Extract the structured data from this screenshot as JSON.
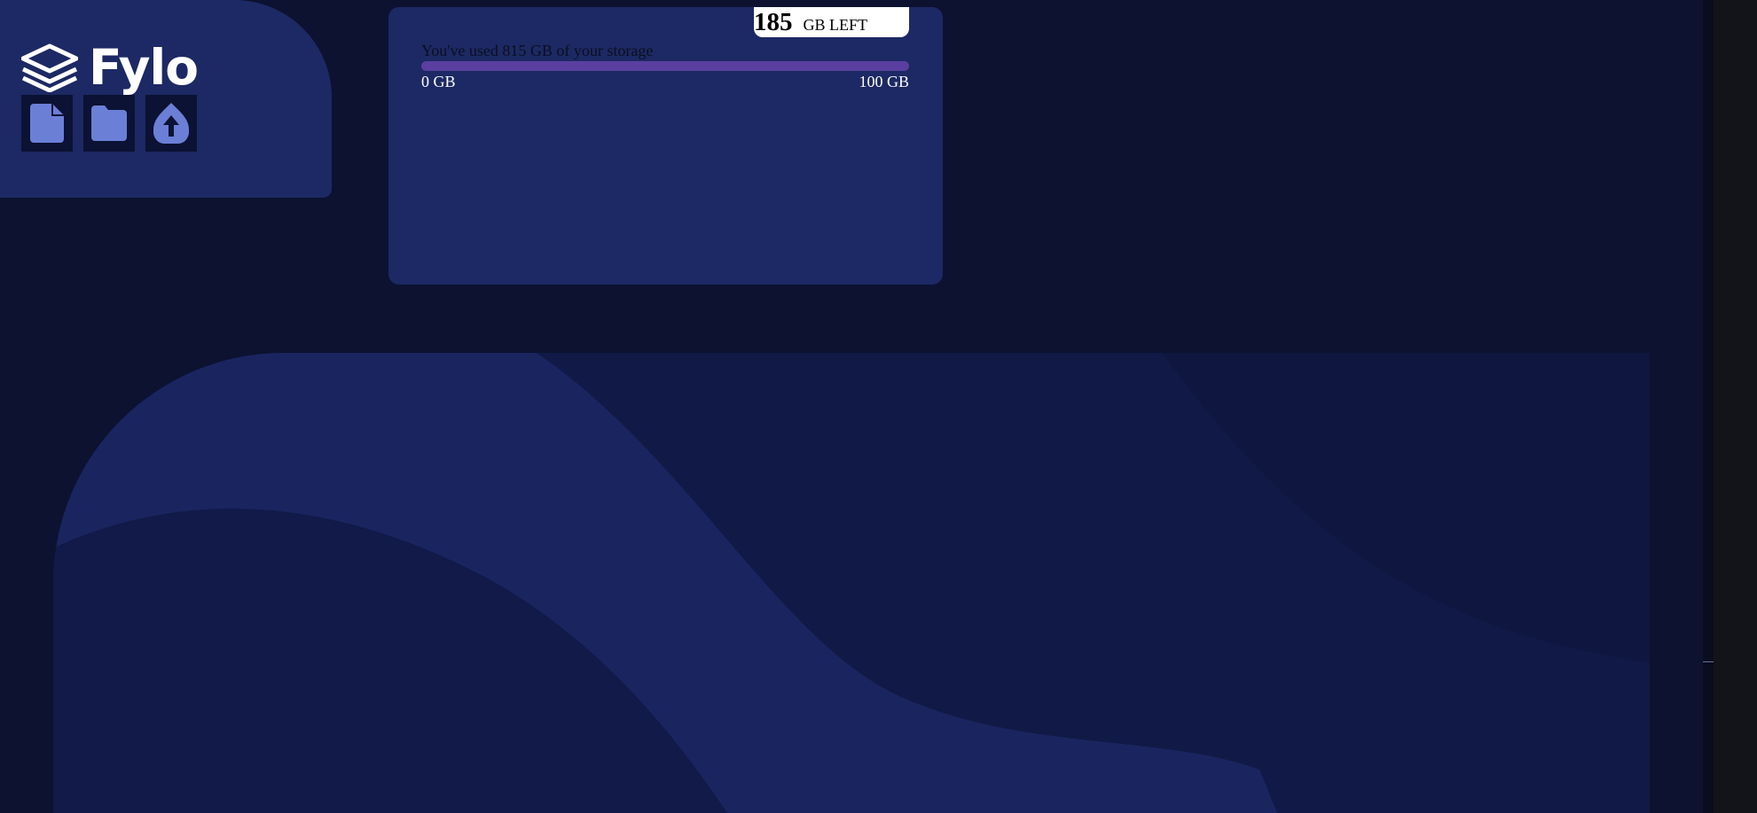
{
  "app": {
    "name": "Fylo"
  },
  "toolbar": {
    "buttons": [
      {
        "icon": "document-icon",
        "label": ""
      },
      {
        "icon": "folder-icon",
        "label": ""
      },
      {
        "icon": "upload-icon",
        "label": ""
      }
    ]
  },
  "storage": {
    "usage_text": "You've used 815 GB of your storage",
    "min_label": "0 GB",
    "max_label": "100 GB",
    "remaining_value": "185",
    "remaining_unit": "GB LEFT",
    "used_fraction": 1.0
  },
  "colors": {
    "page_background": "#0c1230",
    "card_background": "#1d2964",
    "icon_accent": "#6b7fd7",
    "progress_fill": "#5a3fa0",
    "badge_background": "#ffffff"
  }
}
